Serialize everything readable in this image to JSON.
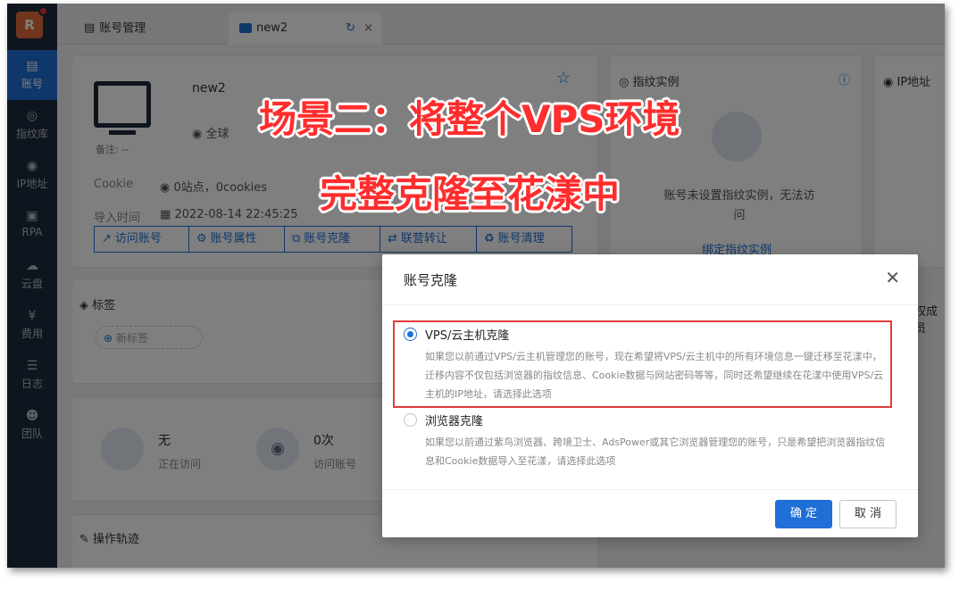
{
  "sidebar": {
    "logo_letter": "R",
    "items": [
      {
        "label": "账号",
        "icon": "id-card-icon"
      },
      {
        "label": "指纹库",
        "icon": "fingerprint-icon"
      },
      {
        "label": "IP地址",
        "icon": "ip-icon"
      },
      {
        "label": "RPA",
        "icon": "robot-icon"
      },
      {
        "label": "云盘",
        "icon": "cloud-drive-icon"
      },
      {
        "label": "费用",
        "icon": "yen-icon"
      },
      {
        "label": "日志",
        "icon": "log-icon"
      },
      {
        "label": "团队",
        "icon": "team-icon"
      }
    ]
  },
  "tabs": [
    {
      "label": "账号管理"
    },
    {
      "label": "new2"
    }
  ],
  "account": {
    "name": "new2",
    "region": "全球",
    "note": "备注: --",
    "cookie_label": "Cookie",
    "cookie_value": "0站点，0cookies",
    "import_label": "导入时间",
    "import_time": "2022-08-14 22:45:25",
    "buttons": [
      "访问账号",
      "账号属性",
      "账号克隆",
      "联营转让",
      "账号清理"
    ]
  },
  "fingerprint_panel": {
    "title": "指纹实例",
    "message": "账号未设置指纹实例，无法访问",
    "link": "绑定指纹实例"
  },
  "ip_panel": {
    "title": "IP地址"
  },
  "tags_panel": {
    "title": "标签",
    "add_label": "新标签"
  },
  "stats": [
    {
      "value": "无",
      "label": "正在访问"
    },
    {
      "value": "0次",
      "label": "访问账号"
    }
  ],
  "track_panel": {
    "title": "操作轨迹"
  },
  "members_label": "权成员",
  "headline": {
    "line1": "场景二：将整个VPS环境",
    "line2": "完整克隆至花漾中"
  },
  "dialog": {
    "title": "账号克隆",
    "options": [
      {
        "title": "VPS/云主机克隆",
        "desc": "如果您以前通过VPS/云主机管理您的账号，现在希望将VPS/云主机中的所有环境信息一键迁移至花漾中，迁移内容不仅包括浏览器的指纹信息、Cookie数据与网站密码等等，同时还希望继续在花漾中使用VPS/云主机的IP地址，请选择此选项",
        "checked": true
      },
      {
        "title": "浏览器克隆",
        "desc": "如果您以前通过紫鸟浏览器、跨境卫士、AdsPower或其它浏览器管理您的账号，只是希望把浏览器指纹信息和Cookie数据导入至花漾，请选择此选项",
        "checked": false
      }
    ],
    "confirm": "确 定",
    "cancel": "取 消"
  },
  "colors": {
    "primary": "#1f6fd6",
    "sidebar": "#1f2a3c",
    "highlight": "#e03c3c",
    "headline": "#ff2d2d"
  }
}
